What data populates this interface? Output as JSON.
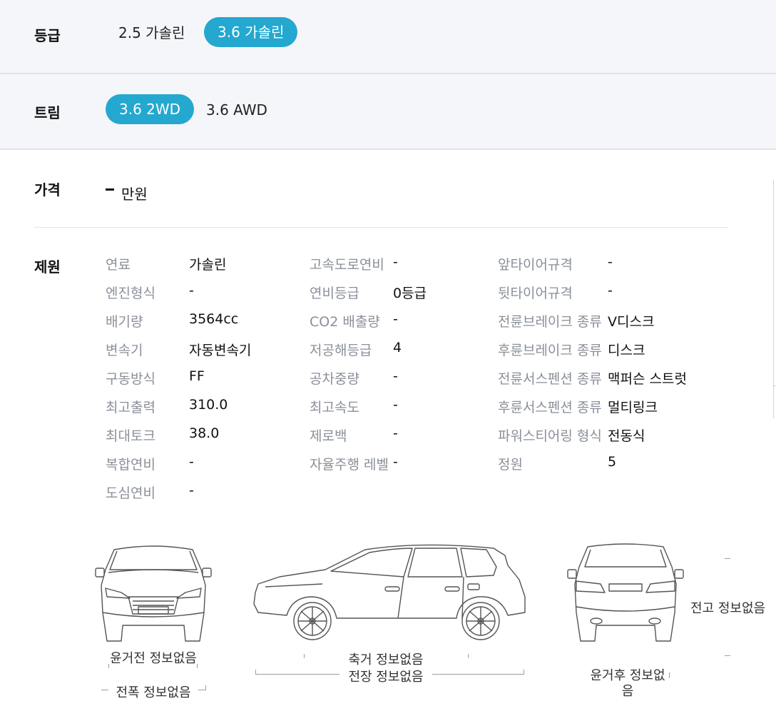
{
  "grade": {
    "label": "등급",
    "options": [
      {
        "label": "2.5 가솔린",
        "selected": false
      },
      {
        "label": "3.6 가솔린",
        "selected": true
      }
    ]
  },
  "trim": {
    "label": "트림",
    "options": [
      {
        "label": "3.6 2WD",
        "selected": true
      },
      {
        "label": "3.6 AWD",
        "selected": false
      }
    ]
  },
  "price": {
    "label": "가격",
    "value": "-",
    "unit": "만원"
  },
  "specs": {
    "label": "제원",
    "col1": [
      {
        "k": "연료",
        "v": "가솔린"
      },
      {
        "k": "엔진형식",
        "v": "-"
      },
      {
        "k": "배기량",
        "v": "3564cc"
      },
      {
        "k": "변속기",
        "v": "자동변속기"
      },
      {
        "k": "구동방식",
        "v": "FF"
      },
      {
        "k": "최고출력",
        "v": "310.0"
      },
      {
        "k": "최대토크",
        "v": "38.0"
      },
      {
        "k": "복합연비",
        "v": "-"
      },
      {
        "k": "도심연비",
        "v": "-"
      }
    ],
    "col2": [
      {
        "k": "고속도로연비",
        "v": "-"
      },
      {
        "k": "연비등급",
        "v": "0등급"
      },
      {
        "k": "CO2 배출량",
        "v": "-"
      },
      {
        "k": "저공해등급",
        "v": "4"
      },
      {
        "k": "공차중량",
        "v": "-"
      },
      {
        "k": "최고속도",
        "v": "-"
      },
      {
        "k": "제로백",
        "v": "-"
      },
      {
        "k": "자율주행 레벨",
        "v": "-"
      }
    ],
    "col3": [
      {
        "k": "앞타이어규격",
        "v": "-"
      },
      {
        "k": "뒷타이어규격",
        "v": "-"
      },
      {
        "k": "전륜브레이크 종류",
        "v": "V디스크"
      },
      {
        "k": "후륜브레이크 종류",
        "v": "디스크"
      },
      {
        "k": "전륜서스펜션 종류",
        "v": "맥퍼슨 스트럿"
      },
      {
        "k": "후륜서스펜션 종류",
        "v": "멀티링크"
      },
      {
        "k": "파워스티어링 형식",
        "v": "전동식"
      },
      {
        "k": "정원",
        "v": "5"
      }
    ]
  },
  "dimensions": {
    "front_track": "윤거전 정보없음",
    "overall_width": "전폭 정보없음",
    "wheelbase": "축거 정보없음",
    "overall_length": "전장 정보없음",
    "rear_track": "윤거후 정보없음",
    "overall_height": "전고 정보없음"
  },
  "colors": {
    "accent": "#24a8cf",
    "band_bg": "#f5f6fa",
    "key_text": "#8a8f99"
  }
}
